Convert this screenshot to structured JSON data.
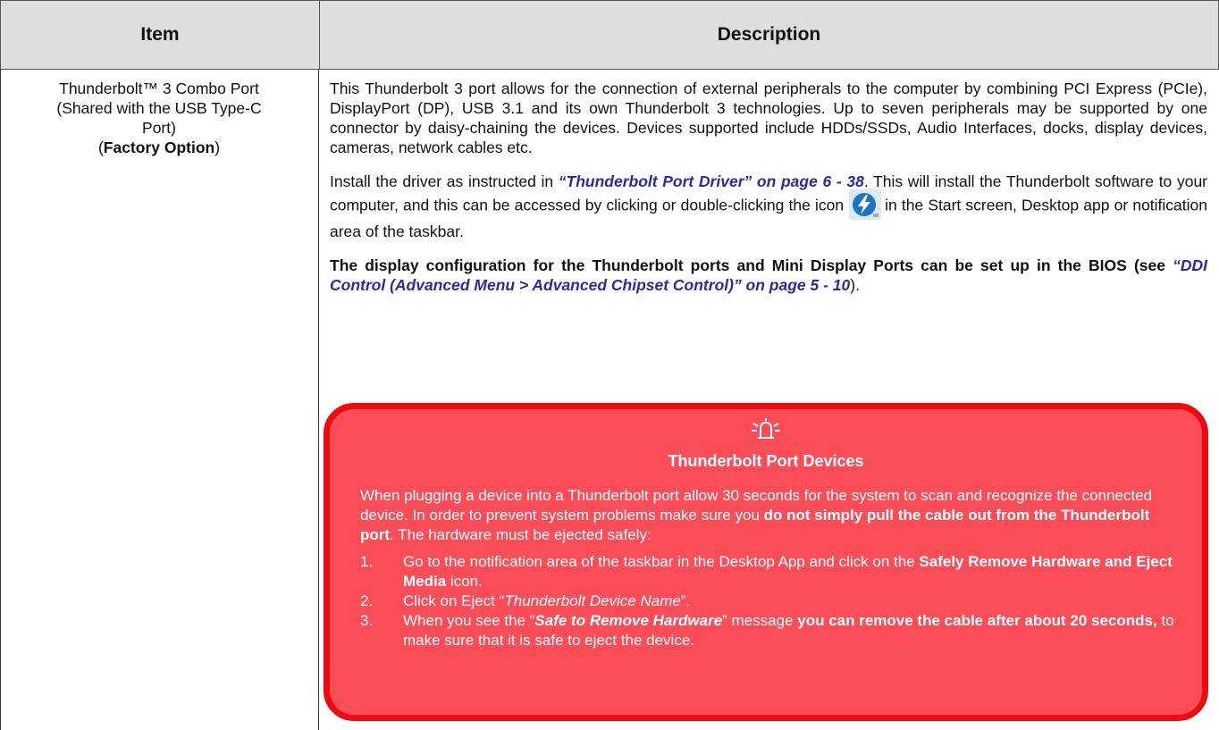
{
  "table": {
    "header_item": "Item",
    "header_description": "Description"
  },
  "item": {
    "line1": "Thunderbolt™ 3 Combo Port",
    "line2": "(Shared with the USB Type-C",
    "line3": "Port)",
    "line4_open": "(",
    "line4_bold": "Factory Option",
    "line4_close": ")"
  },
  "description": {
    "para1": "This Thunderbolt 3 port allows for the connection of external peripherals to the computer by combining PCI Express (PCIe), DisplayPort (DP), USB 3.1 and its own Thunderbolt 3 technologies. Up to seven peripherals may be supported by one connector by daisy-chaining the devices. Devices supported include HDDs/SSDs, Audio Interfaces, docks, display devices, cameras, network cables etc.",
    "para2_before": "Install the driver as instructed in ",
    "para2_link": "“Thunderbolt Port Driver” on page 6 - 38",
    "para2_after": ". This will install the Thunderbolt software to your computer, and this can be accessed by clicking or double-clicking the icon",
    "para2_end": "in the Start screen, Desktop app or notification area of the taskbar.",
    "para3_bold": "The display configuration for the Thunderbolt ports and Mini Display Ports can be set up in the BIOS (see ",
    "para3_link": "“DDI Control (Advanced Menu > Advanced Chipset Control)” on page 5 - 10",
    "para3_end": ")."
  },
  "note": {
    "icon": "alert-bell-icon",
    "title": "Thunderbolt Port Devices",
    "intro_before": "When plugging a device into a Thunderbolt port allow 30 seconds for the system to scan and recognize the connected device. In order to prevent system problems make sure you ",
    "intro_bold": "do not simply pull the cable out from the Thunderbolt port",
    "intro_after": ". The hardware must be ejected safely:",
    "steps": [
      {
        "num": "1.",
        "before": "Go to the notification area of the taskbar in the Desktop App and click on the ",
        "bold": "Safely Remove Hardware and Eject Media",
        "after": " icon."
      },
      {
        "num": "2.",
        "before": "Click on Eject “",
        "italic": "Thunderbolt Device Name",
        "after": "”."
      },
      {
        "num": "3.",
        "before": "When you see the “",
        "bolditalic": "Safe to Remove Hardware",
        "mid": "” message ",
        "bold": "you can remove the cable after about 20 seconds,",
        "after": " to make sure that it is safe to eject the device."
      }
    ]
  },
  "colors": {
    "note_fill": "#fb4d57",
    "note_border": "#ee0a10",
    "link": "#2a2aa8",
    "header_bg": "#dedede"
  }
}
